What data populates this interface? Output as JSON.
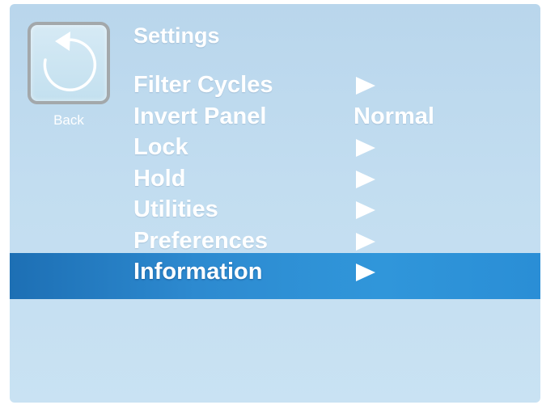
{
  "back": {
    "label": "Back",
    "icon": "back-arrow-icon"
  },
  "header": {
    "title": "Settings"
  },
  "menu": {
    "items": [
      {
        "label": "Filter Cycles",
        "value": "",
        "icon": "arrow-right-icon"
      },
      {
        "label": "Invert Panel",
        "value": "Normal",
        "icon": ""
      },
      {
        "label": "Lock",
        "value": "",
        "icon": "arrow-right-icon"
      },
      {
        "label": "Hold",
        "value": "",
        "icon": "arrow-right-icon"
      },
      {
        "label": "Utilities",
        "value": "",
        "icon": "arrow-right-icon"
      },
      {
        "label": "Preferences",
        "value": "",
        "icon": "arrow-right-icon"
      },
      {
        "label": "Information",
        "value": "",
        "icon": "arrow-right-icon",
        "selected": true
      }
    ]
  },
  "colors": {
    "background": "#c2ddf0",
    "highlight": "#2d8ad0",
    "text": "#ffffff",
    "button_border": "#a3a8ab"
  }
}
